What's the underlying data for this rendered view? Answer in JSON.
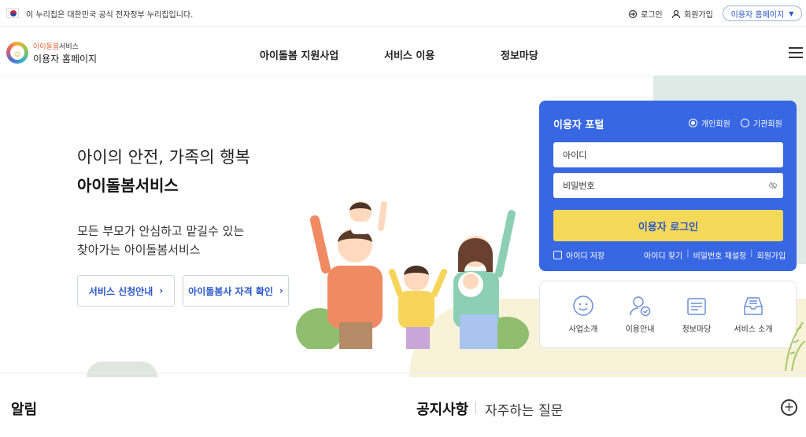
{
  "topbar": {
    "gov_notice": "이 누리집은 대한민국 공식 전자정부 누리집입니다.",
    "login": "로그인",
    "signup": "회원가입",
    "site_select": "이용자 홈페이지"
  },
  "header": {
    "logo_small_brand": "아이돌봄",
    "logo_small_rest": "서비스",
    "logo_big": "이용자 홈페이지",
    "nav": [
      "아이돌봄 지원사업",
      "서비스 이용",
      "정보마당"
    ]
  },
  "hero": {
    "subtitle": "아이의 안전, 가족의 행복",
    "title": "아이돌봄서비스",
    "desc_line1": "모든 부모가 안심하고 맡길수 있는",
    "desc_line2": "찾아가는 아이돌봄서비스",
    "btn_guide": "서비스 신청안내",
    "btn_check": "아이돌봄사 자격 확인"
  },
  "portal": {
    "title": "이용자 포털",
    "radio_personal": "개인회원",
    "radio_org": "기관회원",
    "id_placeholder": "아이디",
    "pw_placeholder": "비밀번호",
    "login_button": "이용자 로그인",
    "save_id": "아이디 저장",
    "find_id": "아이디 찾기",
    "reset_pw": "비밀번호 재설정",
    "join": "회원가입"
  },
  "quick": [
    {
      "label": "사업소개",
      "icon": "smile-face-icon"
    },
    {
      "label": "이용안내",
      "icon": "user-check-icon"
    },
    {
      "label": "정보마당",
      "icon": "document-stack-icon"
    },
    {
      "label": "서비스 소개",
      "icon": "inbox-tray-icon"
    }
  ],
  "sections": {
    "alerts": "알림",
    "notice": "공지사항",
    "faq": "자주하는 질문"
  },
  "colors": {
    "portal_blue": "#3767e3",
    "login_yellow": "#f7d959",
    "link_blue": "#2a57c8"
  }
}
